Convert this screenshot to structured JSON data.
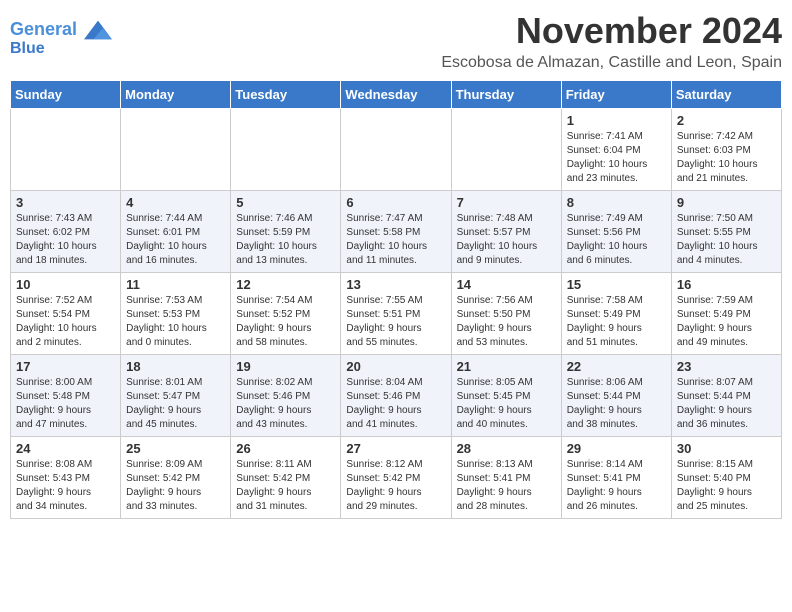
{
  "header": {
    "logo_line1": "General",
    "logo_line2": "Blue",
    "month": "November 2024",
    "location": "Escobosa de Almazan, Castille and Leon, Spain"
  },
  "weekdays": [
    "Sunday",
    "Monday",
    "Tuesday",
    "Wednesday",
    "Thursday",
    "Friday",
    "Saturday"
  ],
  "weeks": [
    [
      {
        "day": "",
        "info": ""
      },
      {
        "day": "",
        "info": ""
      },
      {
        "day": "",
        "info": ""
      },
      {
        "day": "",
        "info": ""
      },
      {
        "day": "",
        "info": ""
      },
      {
        "day": "1",
        "info": "Sunrise: 7:41 AM\nSunset: 6:04 PM\nDaylight: 10 hours\nand 23 minutes."
      },
      {
        "day": "2",
        "info": "Sunrise: 7:42 AM\nSunset: 6:03 PM\nDaylight: 10 hours\nand 21 minutes."
      }
    ],
    [
      {
        "day": "3",
        "info": "Sunrise: 7:43 AM\nSunset: 6:02 PM\nDaylight: 10 hours\nand 18 minutes."
      },
      {
        "day": "4",
        "info": "Sunrise: 7:44 AM\nSunset: 6:01 PM\nDaylight: 10 hours\nand 16 minutes."
      },
      {
        "day": "5",
        "info": "Sunrise: 7:46 AM\nSunset: 5:59 PM\nDaylight: 10 hours\nand 13 minutes."
      },
      {
        "day": "6",
        "info": "Sunrise: 7:47 AM\nSunset: 5:58 PM\nDaylight: 10 hours\nand 11 minutes."
      },
      {
        "day": "7",
        "info": "Sunrise: 7:48 AM\nSunset: 5:57 PM\nDaylight: 10 hours\nand 9 minutes."
      },
      {
        "day": "8",
        "info": "Sunrise: 7:49 AM\nSunset: 5:56 PM\nDaylight: 10 hours\nand 6 minutes."
      },
      {
        "day": "9",
        "info": "Sunrise: 7:50 AM\nSunset: 5:55 PM\nDaylight: 10 hours\nand 4 minutes."
      }
    ],
    [
      {
        "day": "10",
        "info": "Sunrise: 7:52 AM\nSunset: 5:54 PM\nDaylight: 10 hours\nand 2 minutes."
      },
      {
        "day": "11",
        "info": "Sunrise: 7:53 AM\nSunset: 5:53 PM\nDaylight: 10 hours\nand 0 minutes."
      },
      {
        "day": "12",
        "info": "Sunrise: 7:54 AM\nSunset: 5:52 PM\nDaylight: 9 hours\nand 58 minutes."
      },
      {
        "day": "13",
        "info": "Sunrise: 7:55 AM\nSunset: 5:51 PM\nDaylight: 9 hours\nand 55 minutes."
      },
      {
        "day": "14",
        "info": "Sunrise: 7:56 AM\nSunset: 5:50 PM\nDaylight: 9 hours\nand 53 minutes."
      },
      {
        "day": "15",
        "info": "Sunrise: 7:58 AM\nSunset: 5:49 PM\nDaylight: 9 hours\nand 51 minutes."
      },
      {
        "day": "16",
        "info": "Sunrise: 7:59 AM\nSunset: 5:49 PM\nDaylight: 9 hours\nand 49 minutes."
      }
    ],
    [
      {
        "day": "17",
        "info": "Sunrise: 8:00 AM\nSunset: 5:48 PM\nDaylight: 9 hours\nand 47 minutes."
      },
      {
        "day": "18",
        "info": "Sunrise: 8:01 AM\nSunset: 5:47 PM\nDaylight: 9 hours\nand 45 minutes."
      },
      {
        "day": "19",
        "info": "Sunrise: 8:02 AM\nSunset: 5:46 PM\nDaylight: 9 hours\nand 43 minutes."
      },
      {
        "day": "20",
        "info": "Sunrise: 8:04 AM\nSunset: 5:46 PM\nDaylight: 9 hours\nand 41 minutes."
      },
      {
        "day": "21",
        "info": "Sunrise: 8:05 AM\nSunset: 5:45 PM\nDaylight: 9 hours\nand 40 minutes."
      },
      {
        "day": "22",
        "info": "Sunrise: 8:06 AM\nSunset: 5:44 PM\nDaylight: 9 hours\nand 38 minutes."
      },
      {
        "day": "23",
        "info": "Sunrise: 8:07 AM\nSunset: 5:44 PM\nDaylight: 9 hours\nand 36 minutes."
      }
    ],
    [
      {
        "day": "24",
        "info": "Sunrise: 8:08 AM\nSunset: 5:43 PM\nDaylight: 9 hours\nand 34 minutes."
      },
      {
        "day": "25",
        "info": "Sunrise: 8:09 AM\nSunset: 5:42 PM\nDaylight: 9 hours\nand 33 minutes."
      },
      {
        "day": "26",
        "info": "Sunrise: 8:11 AM\nSunset: 5:42 PM\nDaylight: 9 hours\nand 31 minutes."
      },
      {
        "day": "27",
        "info": "Sunrise: 8:12 AM\nSunset: 5:42 PM\nDaylight: 9 hours\nand 29 minutes."
      },
      {
        "day": "28",
        "info": "Sunrise: 8:13 AM\nSunset: 5:41 PM\nDaylight: 9 hours\nand 28 minutes."
      },
      {
        "day": "29",
        "info": "Sunrise: 8:14 AM\nSunset: 5:41 PM\nDaylight: 9 hours\nand 26 minutes."
      },
      {
        "day": "30",
        "info": "Sunrise: 8:15 AM\nSunset: 5:40 PM\nDaylight: 9 hours\nand 25 minutes."
      }
    ]
  ]
}
